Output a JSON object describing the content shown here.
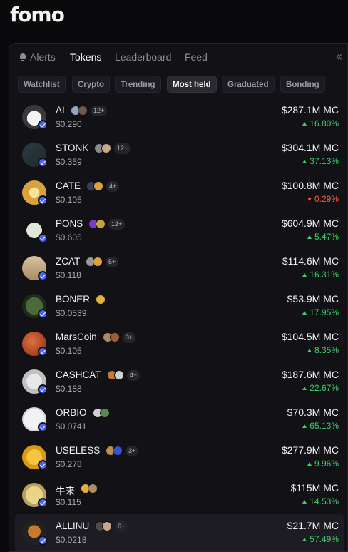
{
  "app": {
    "logo": "fomo"
  },
  "nav": {
    "alerts": "Alerts",
    "tokens": "Tokens",
    "leaderboard": "Leaderboard",
    "feed": "Feed",
    "collapse_icon": "double-chevron-left-icon"
  },
  "filters": [
    "Watchlist",
    "Crypto",
    "Trending",
    "Most held",
    "Graduated",
    "Bonding"
  ],
  "active_filter": "Most held",
  "colors": {
    "up": "#3ecf6a",
    "down": "#ff5a3c",
    "verify": "#4a63ff",
    "background": "#0a0a0c",
    "panel": "#121216"
  },
  "tokens": [
    {
      "name": "AI",
      "price": "$0.290",
      "mc": "$287.1M MC",
      "change": "16.80%",
      "dir": "up",
      "holders_more": "12+",
      "holder_colors": [
        "#8fa9c8",
        "#6e5a4a"
      ],
      "avatar": "cat"
    },
    {
      "name": "STONK",
      "price": "$0.359",
      "mc": "$304.1M MC",
      "change": "37.13%",
      "dir": "up",
      "holders_more": "12+",
      "holder_colors": [
        "#8a8a8a",
        "#c9a88a"
      ],
      "avatar": "stonk"
    },
    {
      "name": "CATE",
      "price": "$0.105",
      "mc": "$100.8M MC",
      "change": "0.29%",
      "dir": "down",
      "holders_more": "4+",
      "holder_colors": [
        "#33405a",
        "#d9a23c"
      ],
      "avatar": "cate"
    },
    {
      "name": "PONS",
      "price": "$0.605",
      "mc": "$604.9M MC",
      "change": "5.47%",
      "dir": "up",
      "holders_more": "12+",
      "holder_colors": [
        "#7a3ad0",
        "#c9a040"
      ],
      "avatar": "pons"
    },
    {
      "name": "ZCAT",
      "price": "$0.118",
      "mc": "$114.6M MC",
      "change": "16.31%",
      "dir": "up",
      "holders_more": "5+",
      "holder_colors": [
        "#9a9a9a",
        "#d9a23c"
      ],
      "avatar": "zcat"
    },
    {
      "name": "BONER",
      "price": "$0.0539",
      "mc": "$53.9M MC",
      "change": "17.95%",
      "dir": "up",
      "holders_more": "",
      "holder_colors": [
        "#e0b040"
      ],
      "avatar": "boner"
    },
    {
      "name": "MarsCoin",
      "price": "$0.105",
      "mc": "$104.5M MC",
      "change": "8.35%",
      "dir": "up",
      "holders_more": "3+",
      "holder_colors": [
        "#b08a60",
        "#a05a3a"
      ],
      "avatar": "mars"
    },
    {
      "name": "CASHCAT",
      "price": "$0.188",
      "mc": "$187.6M MC",
      "change": "22.67%",
      "dir": "up",
      "holders_more": "4+",
      "holder_colors": [
        "#c07a3a",
        "#d0d0d0"
      ],
      "avatar": "cashcat"
    },
    {
      "name": "ORBIO",
      "price": "$0.0741",
      "mc": "$70.3M MC",
      "change": "65.13%",
      "dir": "up",
      "holders_more": "",
      "holder_colors": [
        "#d0d0d0",
        "#5a8a4a"
      ],
      "avatar": "orbio"
    },
    {
      "name": "USELESS",
      "price": "$0.278",
      "mc": "$277.9M MC",
      "change": "9.96%",
      "dir": "up",
      "holders_more": "3+",
      "holder_colors": [
        "#c0904a",
        "#3a50d0"
      ],
      "avatar": "useless"
    },
    {
      "name": "牛来",
      "price": "$0.115",
      "mc": "$115M MC",
      "change": "14.53%",
      "dir": "up",
      "holders_more": "",
      "holder_colors": [
        "#e0b040",
        "#b08a60"
      ],
      "avatar": "niulai"
    },
    {
      "name": "ALLINU",
      "price": "$0.0218",
      "mc": "$21.7M MC",
      "change": "57.49%",
      "dir": "up",
      "holders_more": "6+",
      "holder_colors": [
        "#4a4a4a",
        "#c9a88a"
      ],
      "avatar": "allinu"
    }
  ]
}
